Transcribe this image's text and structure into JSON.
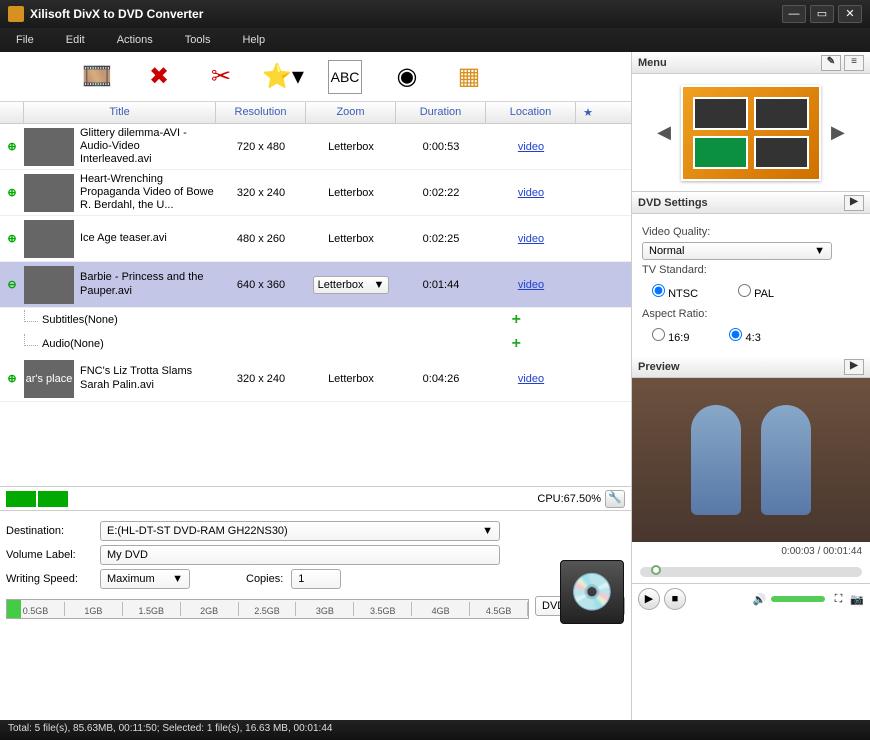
{
  "app": {
    "title": "Xilisoft DivX to DVD Converter"
  },
  "menus": [
    "File",
    "Edit",
    "Actions",
    "Tools",
    "Help"
  ],
  "table": {
    "headers": {
      "title": "Title",
      "resolution": "Resolution",
      "zoom": "Zoom",
      "duration": "Duration",
      "location": "Location",
      "star": "★"
    },
    "rows": [
      {
        "title": "Glittery dilemma-AVI - Audio-Video Interleaved.avi",
        "res": "720 x 480",
        "zoom": "Letterbox",
        "dur": "0:00:53",
        "loc": "video",
        "selected": false
      },
      {
        "title": "Heart-Wrenching Propaganda Video of Bowe R. Berdahl, the U...",
        "res": "320 x 240",
        "zoom": "Letterbox",
        "dur": "0:02:22",
        "loc": "video",
        "selected": false
      },
      {
        "title": "Ice Age teaser.avi",
        "res": "480 x 260",
        "zoom": "Letterbox",
        "dur": "0:02:25",
        "loc": "video",
        "selected": false
      },
      {
        "title": "Barbie - Princess and the Pauper.avi",
        "res": "640 x 360",
        "zoom": "Letterbox",
        "dur": "0:01:44",
        "loc": "video",
        "selected": true,
        "subs": "Subtitles(None)",
        "audio": "Audio(None)"
      },
      {
        "title": "FNC's Liz Trotta Slams Sarah Palin.avi",
        "res": "320 x 240",
        "zoom": "Letterbox",
        "dur": "0:04:26",
        "loc": "video",
        "selected": false,
        "thumbLabel": "ar's place"
      }
    ]
  },
  "cpu": {
    "label": "CPU:67.50%"
  },
  "dest": {
    "label": "Destination:",
    "value": "E:(HL-DT-ST DVD-RAM GH22NS30)",
    "volLabel": "Volume Label:",
    "volValue": "My DVD",
    "speedLabel": "Writing Speed:",
    "speedValue": "Maximum",
    "copiesLabel": "Copies:",
    "copiesValue": "1"
  },
  "gauge": {
    "ticks": [
      "0.5GB",
      "1GB",
      "1.5GB",
      "2GB",
      "2.5GB",
      "3GB",
      "3.5GB",
      "4GB",
      "4.5GB"
    ],
    "format": "DVD"
  },
  "status": "Total: 5 file(s), 85.63MB, 00:11:50; Selected: 1 file(s), 16.63 MB, 00:01:44",
  "right": {
    "menuTitle": "Menu",
    "settingsTitle": "DVD Settings",
    "vqLabel": "Video Quality:",
    "vqValue": "Normal",
    "tvLabel": "TV Standard:",
    "ntsc": "NTSC",
    "pal": "PAL",
    "arLabel": "Aspect Ratio:",
    "ar169": "16:9",
    "ar43": "4:3",
    "previewTitle": "Preview",
    "time": "0:00:03 / 00:01:44"
  }
}
